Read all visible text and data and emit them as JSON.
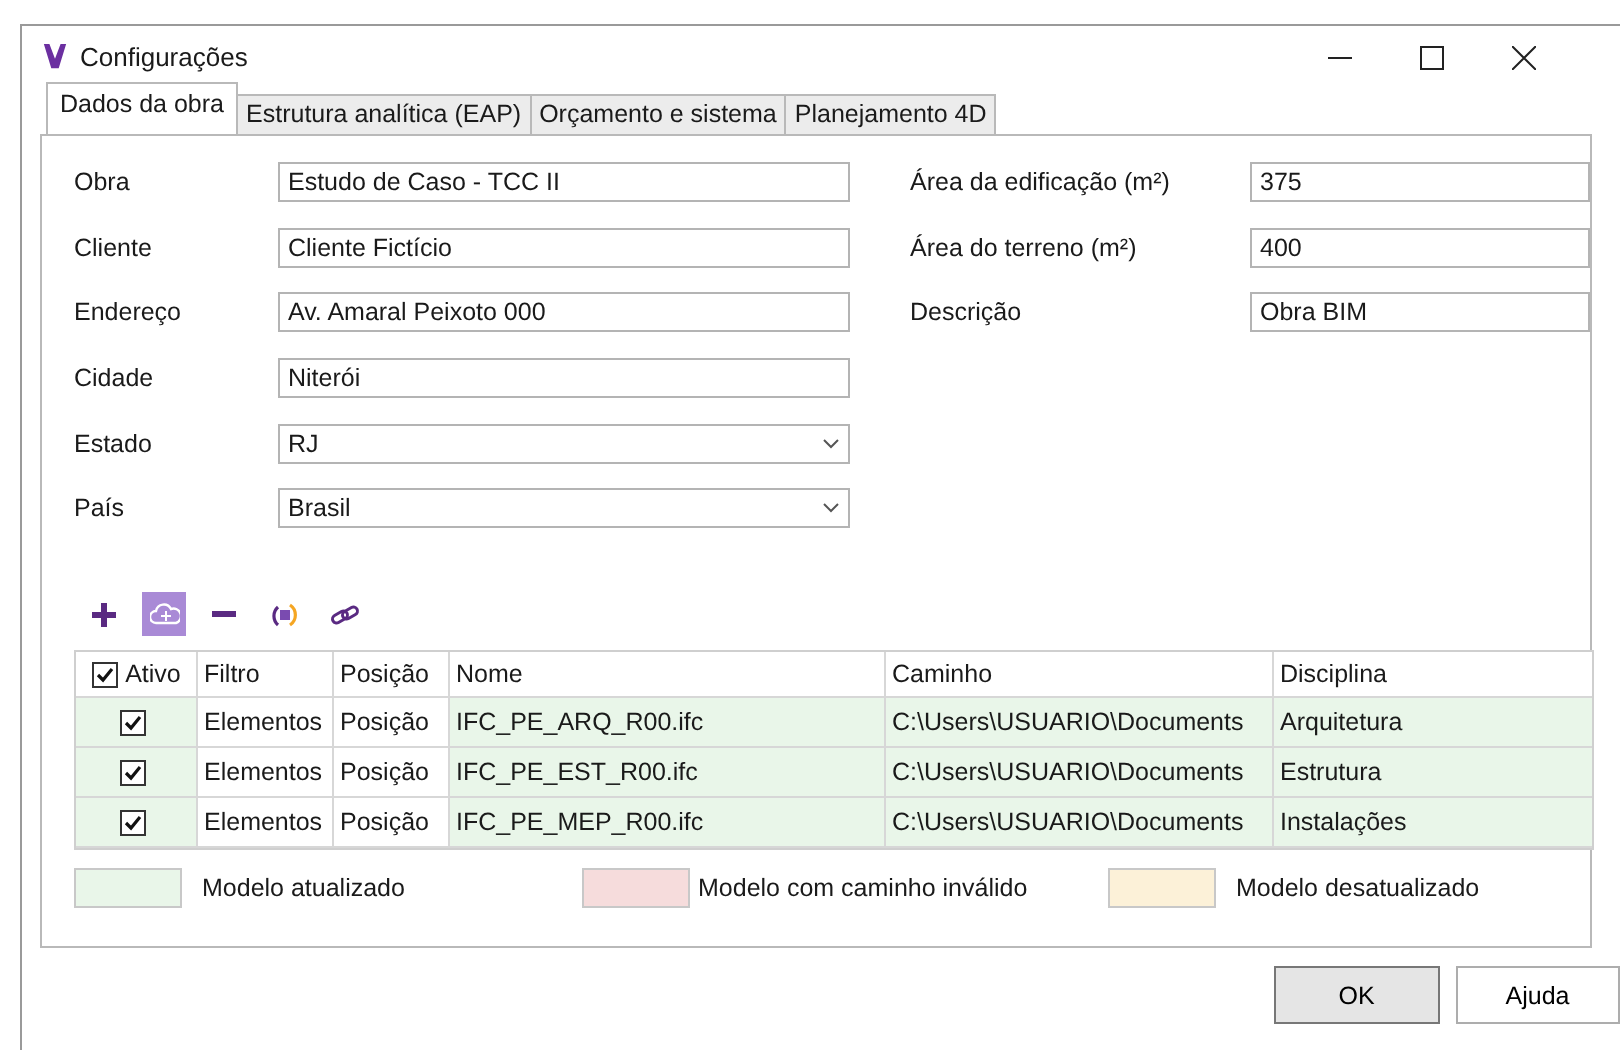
{
  "window": {
    "title": "Configurações"
  },
  "tabs": [
    {
      "label": "Dados da obra",
      "selected": true
    },
    {
      "label": "Estrutura analítica (EAP)",
      "selected": false
    },
    {
      "label": "Orçamento e sistema",
      "selected": false
    },
    {
      "label": "Planejamento 4D",
      "selected": false
    }
  ],
  "form_left": [
    {
      "label": "Obra",
      "value": "Estudo de Caso - TCC II",
      "kind": "text"
    },
    {
      "label": "Cliente",
      "value": "Cliente Fictício",
      "kind": "text"
    },
    {
      "label": "Endereço",
      "value": "Av. Amaral Peixoto 000",
      "kind": "text"
    },
    {
      "label": "Cidade",
      "value": "Niterói",
      "kind": "text"
    },
    {
      "label": "Estado",
      "value": "RJ",
      "kind": "select"
    },
    {
      "label": "País",
      "value": "Brasil",
      "kind": "select"
    }
  ],
  "form_right": [
    {
      "label": "Área da edificação (m²)",
      "value": "375",
      "kind": "text"
    },
    {
      "label": "Área do terreno (m²)",
      "value": "400",
      "kind": "text"
    },
    {
      "label": "Descrição",
      "value": "Obra BIM",
      "kind": "text"
    }
  ],
  "toolbar": [
    {
      "kind": "add",
      "selected": false
    },
    {
      "kind": "cloud",
      "selected": true
    },
    {
      "kind": "remove",
      "selected": false
    },
    {
      "kind": "refresh",
      "selected": false
    },
    {
      "kind": "link",
      "selected": false
    }
  ],
  "table": {
    "header_checked": true,
    "columns": [
      "Ativo",
      "Filtro",
      "Posição",
      "Nome",
      "Caminho",
      "Disciplina"
    ],
    "rows": [
      {
        "checked": true,
        "filter": "Elementos",
        "position": "Posição",
        "name": "IFC_PE_ARQ_R00.ifc",
        "path": "C:\\Users\\USUARIO\\Documents",
        "discipline": "Arquitetura",
        "color": "#e9f6e9"
      },
      {
        "checked": true,
        "filter": "Elementos",
        "position": "Posição",
        "name": "IFC_PE_EST_R00.ifc",
        "path": "C:\\Users\\USUARIO\\Documents",
        "discipline": "Estrutura",
        "color": "#e9f6e9"
      },
      {
        "checked": true,
        "filter": "Elementos",
        "position": "Posição",
        "name": "IFC_PE_MEP_R00.ifc",
        "path": "C:\\Users\\USUARIO\\Documents",
        "discipline": "Instalações",
        "color": "#e9f6e9"
      }
    ]
  },
  "legend": [
    {
      "label": "Modelo atualizado",
      "color": "#e9f6e9"
    },
    {
      "label": "Modelo com caminho inválido",
      "color": "#f6dcdc"
    },
    {
      "label": "Modelo desatualizado",
      "color": "#fcf1d8"
    }
  ],
  "buttons": [
    "OK",
    "Ajuda"
  ]
}
